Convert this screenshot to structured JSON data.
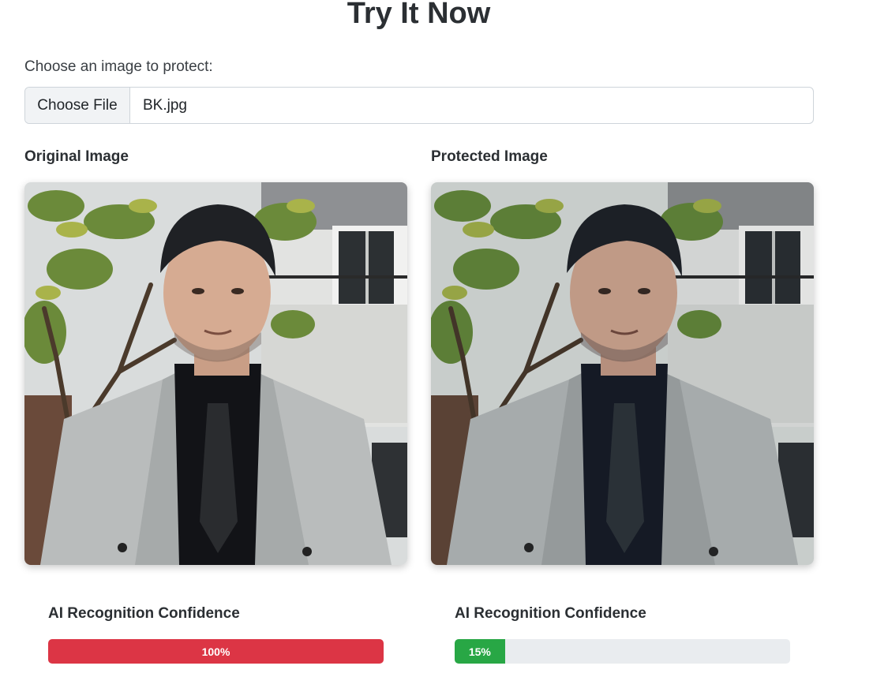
{
  "section": {
    "title": "Try It Now"
  },
  "upload": {
    "label": "Choose an image to protect:",
    "button_label": "Choose File",
    "file_name": "BK.jpg"
  },
  "original": {
    "heading": "Original Image",
    "confidence_label": "AI Recognition Confidence",
    "confidence_value": 1.0,
    "confidence_text": "100%",
    "bar_color": "#dc3545"
  },
  "protected": {
    "heading": "Protected Image",
    "confidence_label": "AI Recognition Confidence",
    "confidence_value": 0.15,
    "confidence_text": "15%",
    "bar_color": "#28a745"
  }
}
